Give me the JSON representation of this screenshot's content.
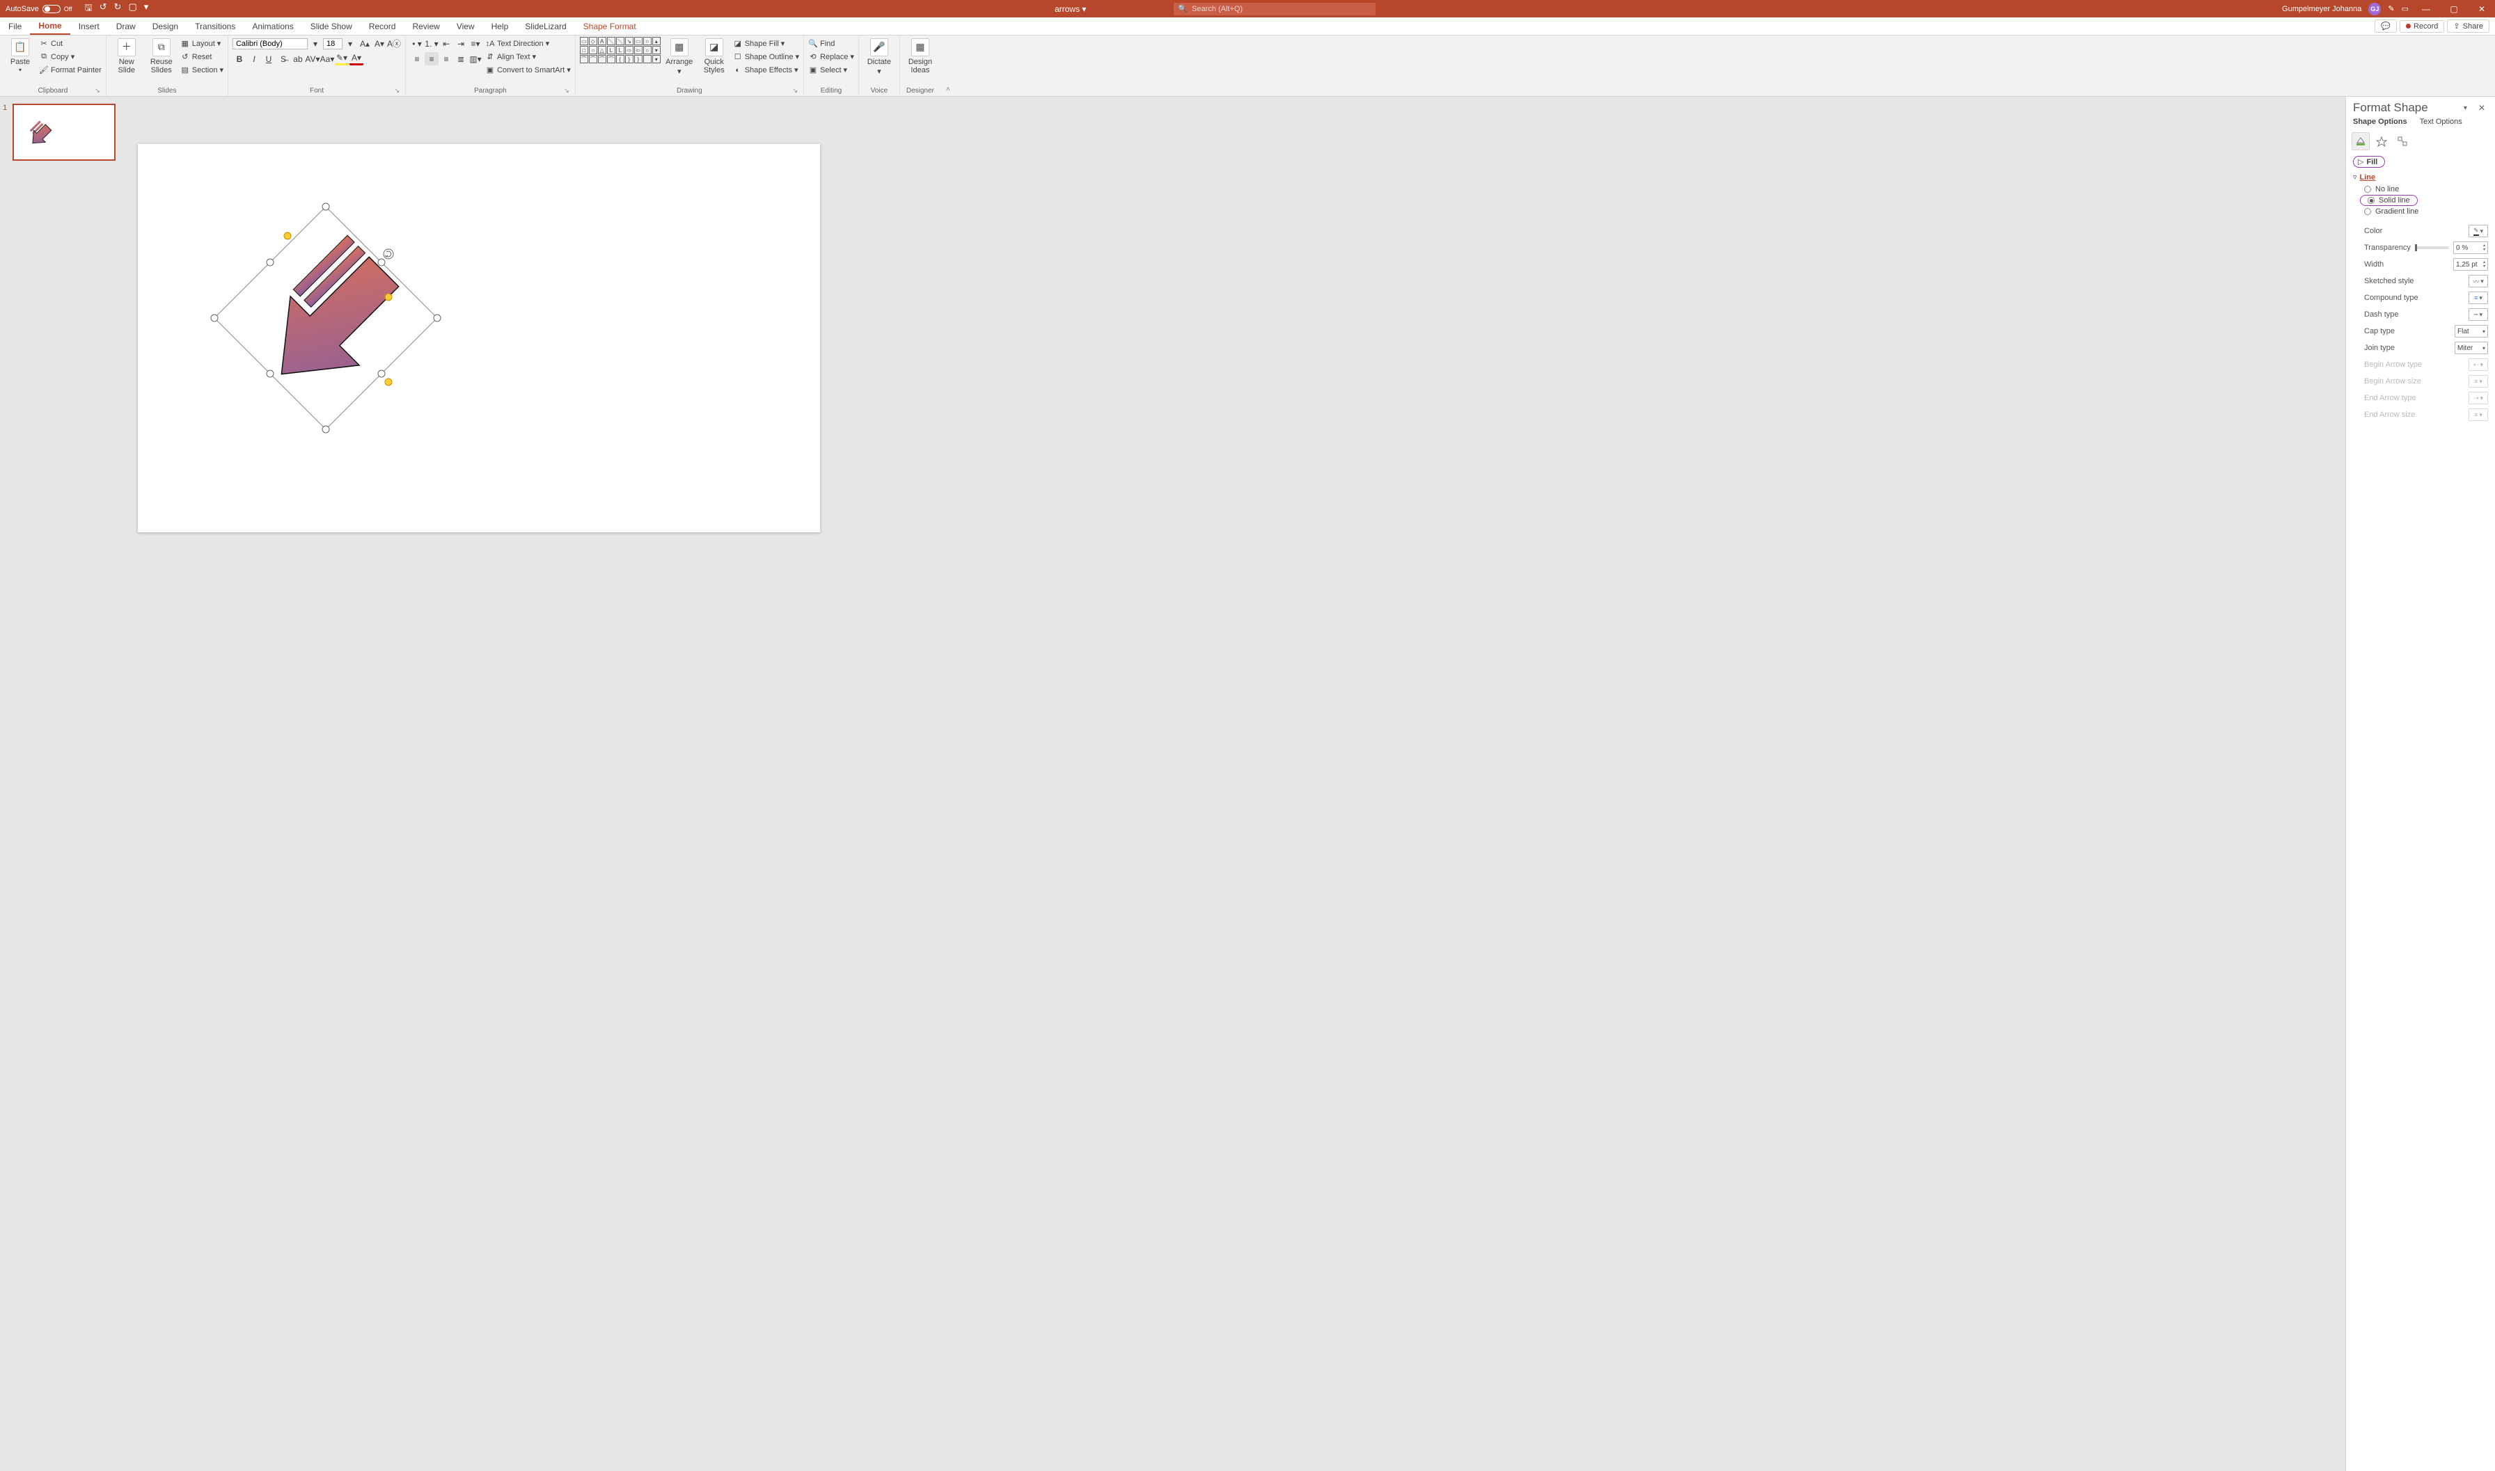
{
  "titlebar": {
    "autosave_label": "AutoSave",
    "autosave_state": "Off",
    "filename": "arrows",
    "search_placeholder": "Search (Alt+Q)",
    "user_name": "Gumpelmeyer Johanna",
    "user_initials": "GJ"
  },
  "tabs": {
    "file": "File",
    "home": "Home",
    "insert": "Insert",
    "draw": "Draw",
    "design": "Design",
    "transitions": "Transitions",
    "animations": "Animations",
    "slideshow": "Slide Show",
    "record": "Record",
    "review": "Review",
    "view": "View",
    "help": "Help",
    "slidelizard": "SlideLizard",
    "shapeformat": "Shape Format",
    "comments": "",
    "record_btn": "Record",
    "share": "Share"
  },
  "ribbon": {
    "clipboard": {
      "label": "Clipboard",
      "paste": "Paste",
      "cut": "Cut",
      "copy": "Copy",
      "format_painter": "Format Painter"
    },
    "slides": {
      "label": "Slides",
      "new_slide": "New\nSlide",
      "reuse_slides": "Reuse\nSlides",
      "layout": "Layout",
      "reset": "Reset",
      "section": "Section"
    },
    "font": {
      "label": "Font",
      "name": "Calibri (Body)",
      "size": "18"
    },
    "paragraph": {
      "label": "Paragraph",
      "text_direction": "Text Direction",
      "align_text": "Align Text",
      "smartart": "Convert to SmartArt"
    },
    "drawing": {
      "label": "Drawing",
      "arrange": "Arrange",
      "quick_styles": "Quick\nStyles",
      "shape_fill": "Shape Fill",
      "shape_outline": "Shape Outline",
      "shape_effects": "Shape Effects"
    },
    "editing": {
      "label": "Editing",
      "find": "Find",
      "replace": "Replace",
      "select": "Select"
    },
    "voice": {
      "label": "Voice",
      "dictate": "Dictate"
    },
    "designer": {
      "label": "Designer",
      "design_ideas": "Design\nIdeas"
    }
  },
  "thumbnail": {
    "index": "1"
  },
  "format_pane": {
    "title": "Format Shape",
    "tab_shape": "Shape Options",
    "tab_text": "Text Options",
    "fill": "Fill",
    "line": "Line",
    "no_line": "No line",
    "solid_line": "Solid line",
    "gradient_line": "Gradient line",
    "color": "Color",
    "transparency": "Transparency",
    "transparency_val": "0 %",
    "width": "Width",
    "width_val": "1,25 pt",
    "sketched": "Sketched style",
    "compound": "Compound type",
    "dash": "Dash type",
    "cap": "Cap type",
    "cap_val": "Flat",
    "join": "Join type",
    "join_val": "Miter",
    "begin_arrow_type": "Begin Arrow type",
    "begin_arrow_size": "Begin Arrow size",
    "end_arrow_type": "End Arrow type",
    "end_arrow_size": "End Arrow size"
  }
}
